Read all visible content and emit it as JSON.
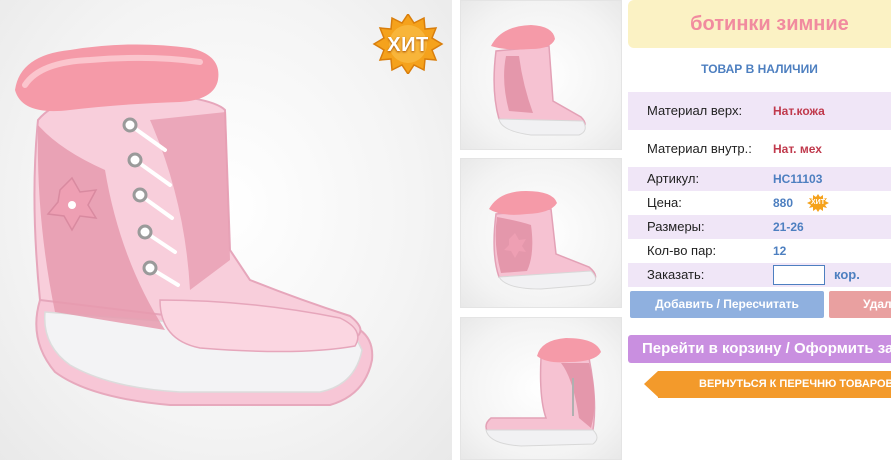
{
  "badge": {
    "hit": "ХИТ"
  },
  "product": {
    "title": "ботинки зимние",
    "stock": "ТОВАР В НАЛИЧИИ",
    "specs": [
      {
        "label": "Материал верх:",
        "value": "Нат.кожа"
      },
      {
        "label": "Материал внутр.:",
        "value": "Нат. мех"
      },
      {
        "label": "Артикул:",
        "value": "НС11103"
      },
      {
        "label": "Цена:",
        "value": "880"
      },
      {
        "label": "Размеры:",
        "value": "21-26"
      },
      {
        "label": "Кол-во пар:",
        "value": "12"
      }
    ],
    "order_label": "Заказать:",
    "order_unit": "кор.",
    "price_badge": "ХИТ"
  },
  "buttons": {
    "recalc": "Добавить / Пересчитать",
    "delete": "Удалить",
    "cart": "Перейти в корзину / Оформить заказ",
    "back": "ВЕРНУТЬСЯ К ПЕРЕЧНЮ ТОВАРОВ"
  },
  "colors": {
    "title_bg": "#fbf2c4",
    "title_text": "#f18b9f",
    "accent_blue": "#4d7fc0",
    "accent_red": "#c0394c",
    "row_lilac": "#f0e6f7",
    "cart_purple": "#c98fe0",
    "back_orange": "#f39a2b",
    "boot_pink": "#f6c2d2",
    "fur_pink": "#f59aa8"
  }
}
